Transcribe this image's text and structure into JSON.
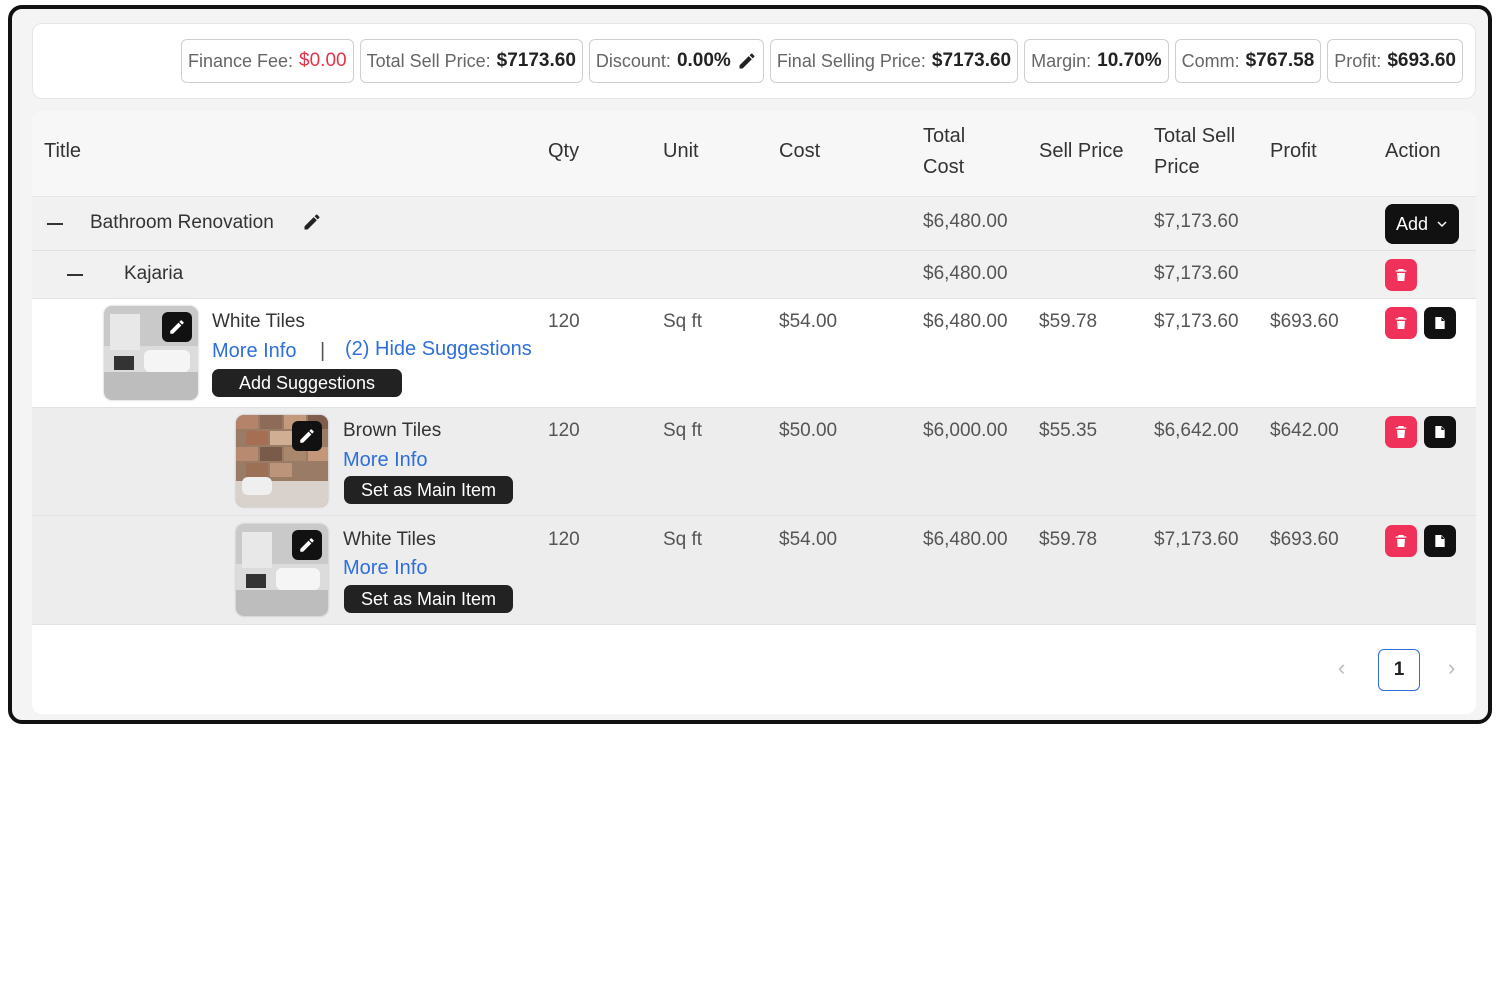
{
  "summary": {
    "finance_fee_label": "Finance Fee:",
    "finance_fee_value": "$0.00",
    "total_sell_label": "Total Sell Price:",
    "total_sell_value": "$7173.60",
    "discount_label": "Discount:",
    "discount_value": "0.00%",
    "final_selling_label": "Final Selling Price:",
    "final_selling_value": "$7173.60",
    "margin_label": "Margin:",
    "margin_value": "10.70%",
    "comm_label": "Comm:",
    "comm_value": "$767.58",
    "profit_label": "Profit:",
    "profit_value": "$693.60"
  },
  "columns": {
    "title": "Title",
    "qty": "Qty",
    "unit": "Unit",
    "cost": "Cost",
    "total_cost_1": "Total",
    "total_cost_2": "Cost",
    "sell_price": "Sell Price",
    "total_sell_1": "Total Sell",
    "total_sell_2": "Price",
    "profit": "Profit",
    "action": "Action"
  },
  "group": {
    "title": "Bathroom Renovation",
    "total_cost": "$6,480.00",
    "total_sell": "$7,173.60",
    "add_label": "Add"
  },
  "subgroup": {
    "title": "Kajaria",
    "total_cost": "$6,480.00",
    "total_sell": "$7,173.60"
  },
  "main_item": {
    "title": "White Tiles",
    "more_info": "More Info",
    "separator": "|",
    "hide_suggestions": "(2) Hide Suggestions",
    "add_suggestions": "Add Suggestions",
    "qty": "120",
    "unit": "Sq ft",
    "cost": "$54.00",
    "total_cost": "$6,480.00",
    "sell_price": "$59.78",
    "total_sell": "$7,173.60",
    "profit": "$693.60"
  },
  "suggestions": [
    {
      "title": "Brown Tiles",
      "more_info": "More Info",
      "set_main": "Set as Main Item",
      "qty": "120",
      "unit": "Sq ft",
      "cost": "$50.00",
      "total_cost": "$6,000.00",
      "sell_price": "$55.35",
      "total_sell": "$6,642.00",
      "profit": "$642.00"
    },
    {
      "title": "White Tiles",
      "more_info": "More Info",
      "set_main": "Set as Main Item",
      "qty": "120",
      "unit": "Sq ft",
      "cost": "$54.00",
      "total_cost": "$6,480.00",
      "sell_price": "$59.78",
      "total_sell": "$7,173.60",
      "profit": "$693.60"
    }
  ],
  "pagination": {
    "prev": "‹",
    "current": "1",
    "next": "›"
  },
  "colors": {
    "accent_link": "#2f6fdb",
    "delete_button": "#f0325a",
    "finance_fee_red": "#e5334a"
  },
  "icons": [
    "pencil-icon",
    "minus-icon",
    "trash-icon",
    "document-icon",
    "chevron-down-icon"
  ]
}
